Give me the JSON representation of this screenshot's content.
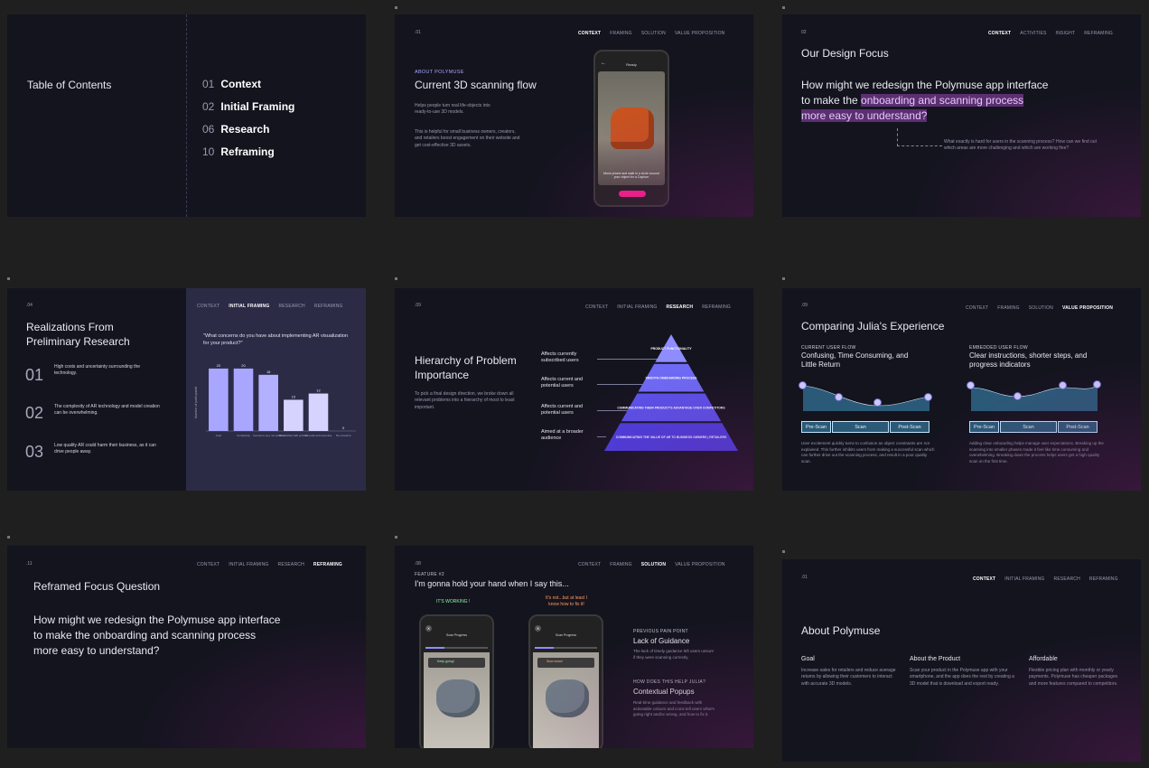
{
  "slide1": {
    "title": "Table of Contents",
    "items": [
      {
        "num": "01",
        "label": "Context"
      },
      {
        "num": "02",
        "label": "Initial Framing"
      },
      {
        "num": "06",
        "label": "Research"
      },
      {
        "num": "10",
        "label": "Reframing"
      }
    ]
  },
  "slide2": {
    "num": ".01",
    "nav": [
      "CONTEXT",
      "FRAMING",
      "SOLUTION",
      "VALUE PROPOSITION"
    ],
    "kicker": "ABOUT POLYMUSE",
    "title": "Current 3D scanning flow",
    "desc1": "Helps people turn real life-objects into ready-to-use 3D models.",
    "desc2": "This is helpful for small business owners, creators, and retailers boost engagement on their website and get cost-effective 3D assets.",
    "phone_header": "Ready",
    "phone_caption": "Move phone and walk in a circle around your object for a Capture"
  },
  "slide3": {
    "num": "02",
    "nav": [
      "CONTEXT",
      "ACTIVITIES",
      "INSIGHT",
      "REFRAMING"
    ],
    "title": "Our Design Focus",
    "q_part1": "How might we redesign the Polymuse app interface to make the ",
    "q_highlight": "onboarding and scanning process more easy to understand?",
    "note": "What exactly is hard for users in the scanning process? How can we find out which areas are more challenging and which are working fine?"
  },
  "slide4": {
    "num": ".04",
    "nav": [
      "CONTEXT",
      "INITIAL FRAMING",
      "RESEARCH",
      "REFRAMING"
    ],
    "title": "Realizations From Preliminary Research",
    "points": [
      {
        "num": "01",
        "text": "High costs and uncertainty surrounding the technology."
      },
      {
        "num": "02",
        "text": "The complexity of AR technology and model creation can be overwhelming."
      },
      {
        "num": "03",
        "text": "Low quality AR could harm their business, as it can drive people away."
      }
    ],
    "chart_question": "\"What concerns do you have about implementing AR visualization for your product?\"",
    "chart_data": {
      "type": "bar",
      "ylabel": "Number of participants",
      "categories": [
        "Cost",
        "Complexity",
        "Concerns very not worth it",
        "Dissatisfied with product",
        "No tools and expertise",
        "No concerns"
      ],
      "values": [
        20,
        20,
        18,
        10,
        12,
        0
      ],
      "ylim": [
        0,
        22
      ]
    }
  },
  "slide5": {
    "num": ".09",
    "nav": [
      "CONTEXT",
      "INITIAL FRAMING",
      "RESEARCH",
      "REFRAMING"
    ],
    "title": "Hierarchy of Problem Importance",
    "desc": "To pick a final design direction, we broke down all relevant problems into a hierarchy of most to least important.",
    "tags": [
      "Affects currently subscribed users",
      "Affects current and potential users",
      "Affects current and potential users",
      "Aimed at a broader audience"
    ],
    "levels": [
      "PRODUCT FUNCTIONALITY",
      "SMOOTH ONBOARDING PROCESS",
      "COMMUNICATING THEIR PRODUCT'S ADVANTAGE OVER COMPETITORS",
      "COMMUNICATING THE VALUE OF AR TO BUSINESS OWNERS | RETAILERS"
    ],
    "colors": [
      "#8f8cff",
      "#6e6af5",
      "#5b52ec",
      "#4a3fe0"
    ]
  },
  "slide6": {
    "num": ".09",
    "nav": [
      "CONTEXT",
      "FRAMING",
      "SOLUTION",
      "VALUE PROPOSITION"
    ],
    "title": "Comparing Julia's Experience",
    "left_kicker": "CURRENT USER FLOW",
    "left_title": "Confusing, Time Consuming, and Little Return",
    "left_desc": "User excitement quickly turns to confusion as object constraints are not explained. This further inhibits users from making a successful scan which can further drive out the scanning process, and result in a poor quality scan.",
    "right_kicker": "EMBEDDED USER FLOW",
    "right_title": "Clear instructions, shorter steps, and progress indicators",
    "right_desc": "Adding clear onboarding helps manage user expectations. Breaking up the scanning into smaller phases made it feel like time consuming and overwhelming. Breaking down the process helps users get a high quality scan on the first time.",
    "stages": [
      "Pre-Scan",
      "Scan",
      "Post-Scan"
    ]
  },
  "slide7": {
    "num": ".11",
    "nav": [
      "CONTEXT",
      "INITIAL FRAMING",
      "RESEARCH",
      "REFRAMING"
    ],
    "title": "Reframed Focus Question",
    "question": "How might we redesign the Polymuse app interface to make the onboarding and scanning process more easy to understand?"
  },
  "slide8": {
    "num": ".08",
    "nav": [
      "CONTEXT",
      "FRAMING",
      "SOLUTION",
      "VALUE PROPOSITION"
    ],
    "kicker": "FEATURE #2",
    "title": "I'm gonna hold your hand when I say this...",
    "label_left": "IT'S WORKING !",
    "label_right": "It's not...but at least I know how to fix it!",
    "phone_title": "Scan Progress",
    "pop_left": "Keep going!",
    "pop_right": "Slow down!",
    "pain_kicker": "PREVIOUS PAIN POINT",
    "pain_title": "Lack of Guidance",
    "pain_desc": "The lack of timely guidance left users unsure if they were scanning correctly.",
    "help_kicker": "HOW DOES THIS HELP JULIA?",
    "help_title": "Contextual Popups",
    "help_desc": "Real-time guidance and feedback with actionable colours and icons tell users what's going right and/or wrong, and how to fix it."
  },
  "slide9": {
    "num": ".01",
    "nav": [
      "CONTEXT",
      "INITIAL FRAMING",
      "RESEARCH",
      "REFRAMING"
    ],
    "title": "About Polymuse",
    "cols": [
      {
        "title": "Goal",
        "text": "Increase sales for retailers and reduce average returns by allowing their customers to interact with accurate 3D models."
      },
      {
        "title": "About the Product",
        "text": "Scan your product in the Polymuse app with your smartphone, and the app does the rest by creating a 3D model that is download and export ready."
      },
      {
        "title": "Affordable",
        "text": "Flexible pricing plan with monthly or yearly payments. Polymuse has cheaper packages and more features compared to competitors."
      }
    ]
  }
}
